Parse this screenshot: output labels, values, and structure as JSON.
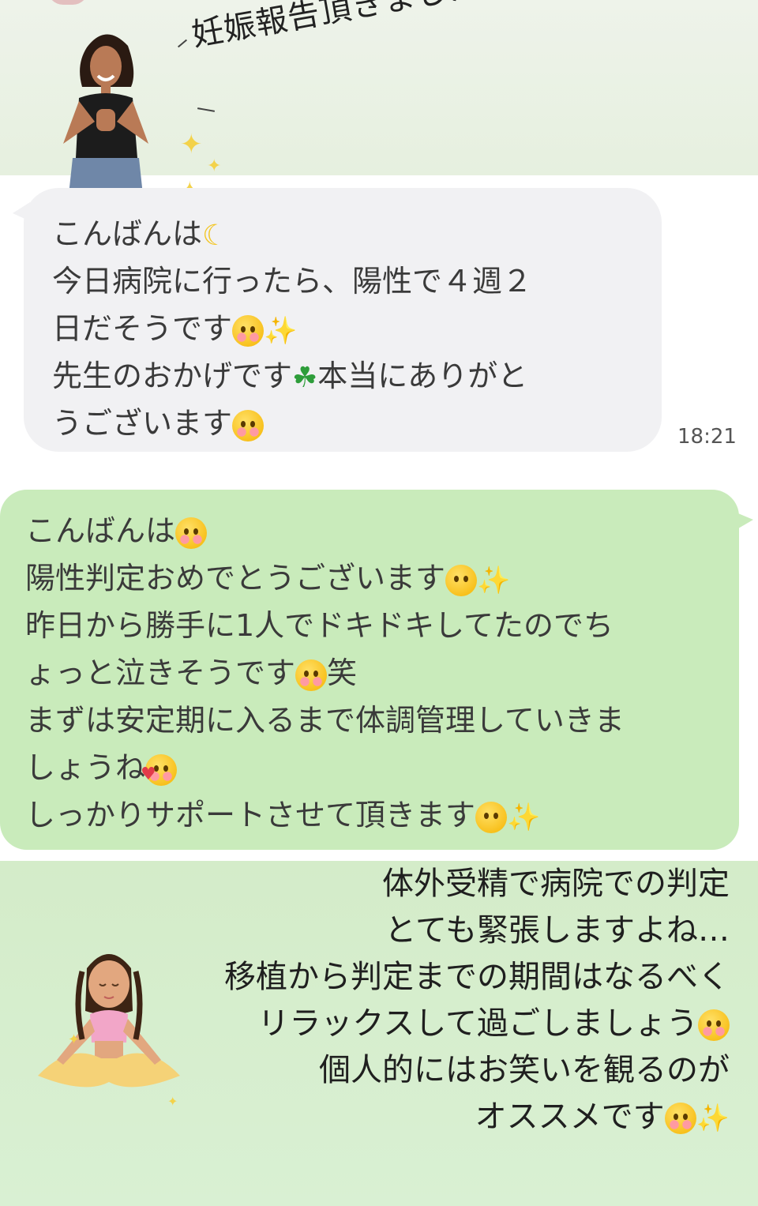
{
  "header": {
    "title": "妊娠報告頂きました"
  },
  "incoming": {
    "lines": [
      "こんばんは",
      "今日病院に行ったら、陽性で４週２",
      "日だそうです",
      "先生のおかげです",
      "本当にありがと",
      "うございます"
    ],
    "time": "18:21"
  },
  "outgoing": {
    "lines": [
      "こんばんは",
      "陽性判定おめでとうございます",
      "昨日から勝手に1人でドキドキしてたのでち",
      "ょっと泣きそうです",
      "笑",
      "まずは安定期に入るまで体調管理していきま",
      "しょうね",
      "しっかりサポートさせて頂きます"
    ]
  },
  "note": {
    "lines": [
      "体外受精で病院での判定",
      "とても緊張しますよね…",
      "移植から判定までの期間はなるべく",
      "リラックスして過ごしましょう",
      "個人的にはお笑いを観るのが",
      "オススメです"
    ]
  },
  "icons": [
    "woman-photo-icon",
    "yoga-illustration-icon",
    "sparkle-icon",
    "moon-icon",
    "clover-icon",
    "smile-face-icon",
    "pleading-face-icon",
    "laughing-face-icon",
    "hearts-face-icon",
    "salute-face-icon"
  ],
  "colors": {
    "incoming_bubble": "#f1f1f3",
    "outgoing_bubble": "#c9ebbb",
    "background": "#d7edd0"
  }
}
